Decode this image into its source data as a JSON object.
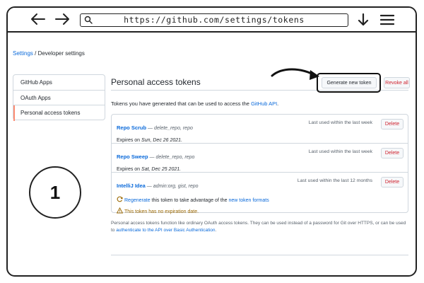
{
  "browser": {
    "url": "https://github.com/settings/tokens"
  },
  "breadcrumb": {
    "root": "Settings",
    "separator": " / ",
    "current": "Developer settings"
  },
  "sidebar": {
    "items": [
      {
        "label": "GitHub Apps"
      },
      {
        "label": "OAuth Apps"
      },
      {
        "label": "Personal access tokens"
      }
    ]
  },
  "step": {
    "number": "1"
  },
  "main": {
    "title": "Personal access tokens",
    "generate_label": "Generate new token",
    "revoke_label": "Revoke all",
    "intro_text": "Tokens you have generated that can be used to access the ",
    "intro_link": "GitHub API",
    "intro_end": "."
  },
  "tokens": [
    {
      "name": "Repo Scrub",
      "scopes": " — delete_repo, repo",
      "expiry_prefix": "Expires on ",
      "expiry_date": "Sun, Dec 26 2021.",
      "last_used": "Last used within the last week",
      "delete_label": "Delete"
    },
    {
      "name": "Repo Sweep",
      "scopes": " — delete_repo, repo",
      "expiry_prefix": "Expires on ",
      "expiry_date": "Sat, Dec 25 2021.",
      "last_used": "Last used within the last week",
      "delete_label": "Delete"
    },
    {
      "name": "IntelliJ Idea",
      "scopes": " — admin:org, gist, repo",
      "last_used": "Last used within the last 12 months",
      "delete_label": "Delete",
      "regen_link": "Regenerate",
      "regen_text": " this token to take advantage of the ",
      "regen_link2": "new token formats",
      "warning": "This token has no expiration date."
    }
  ],
  "footer": {
    "text": "Personal access tokens function like ordinary OAuth access tokens. They can be used instead of a password for Git over HTTPS, or can be used to ",
    "link": "authenticate to the API over Basic Authentication",
    "end": "."
  },
  "colors": {
    "link": "#0969da",
    "danger": "#cf222e",
    "warning": "#9a6700",
    "active_marker": "#fd8c73"
  }
}
